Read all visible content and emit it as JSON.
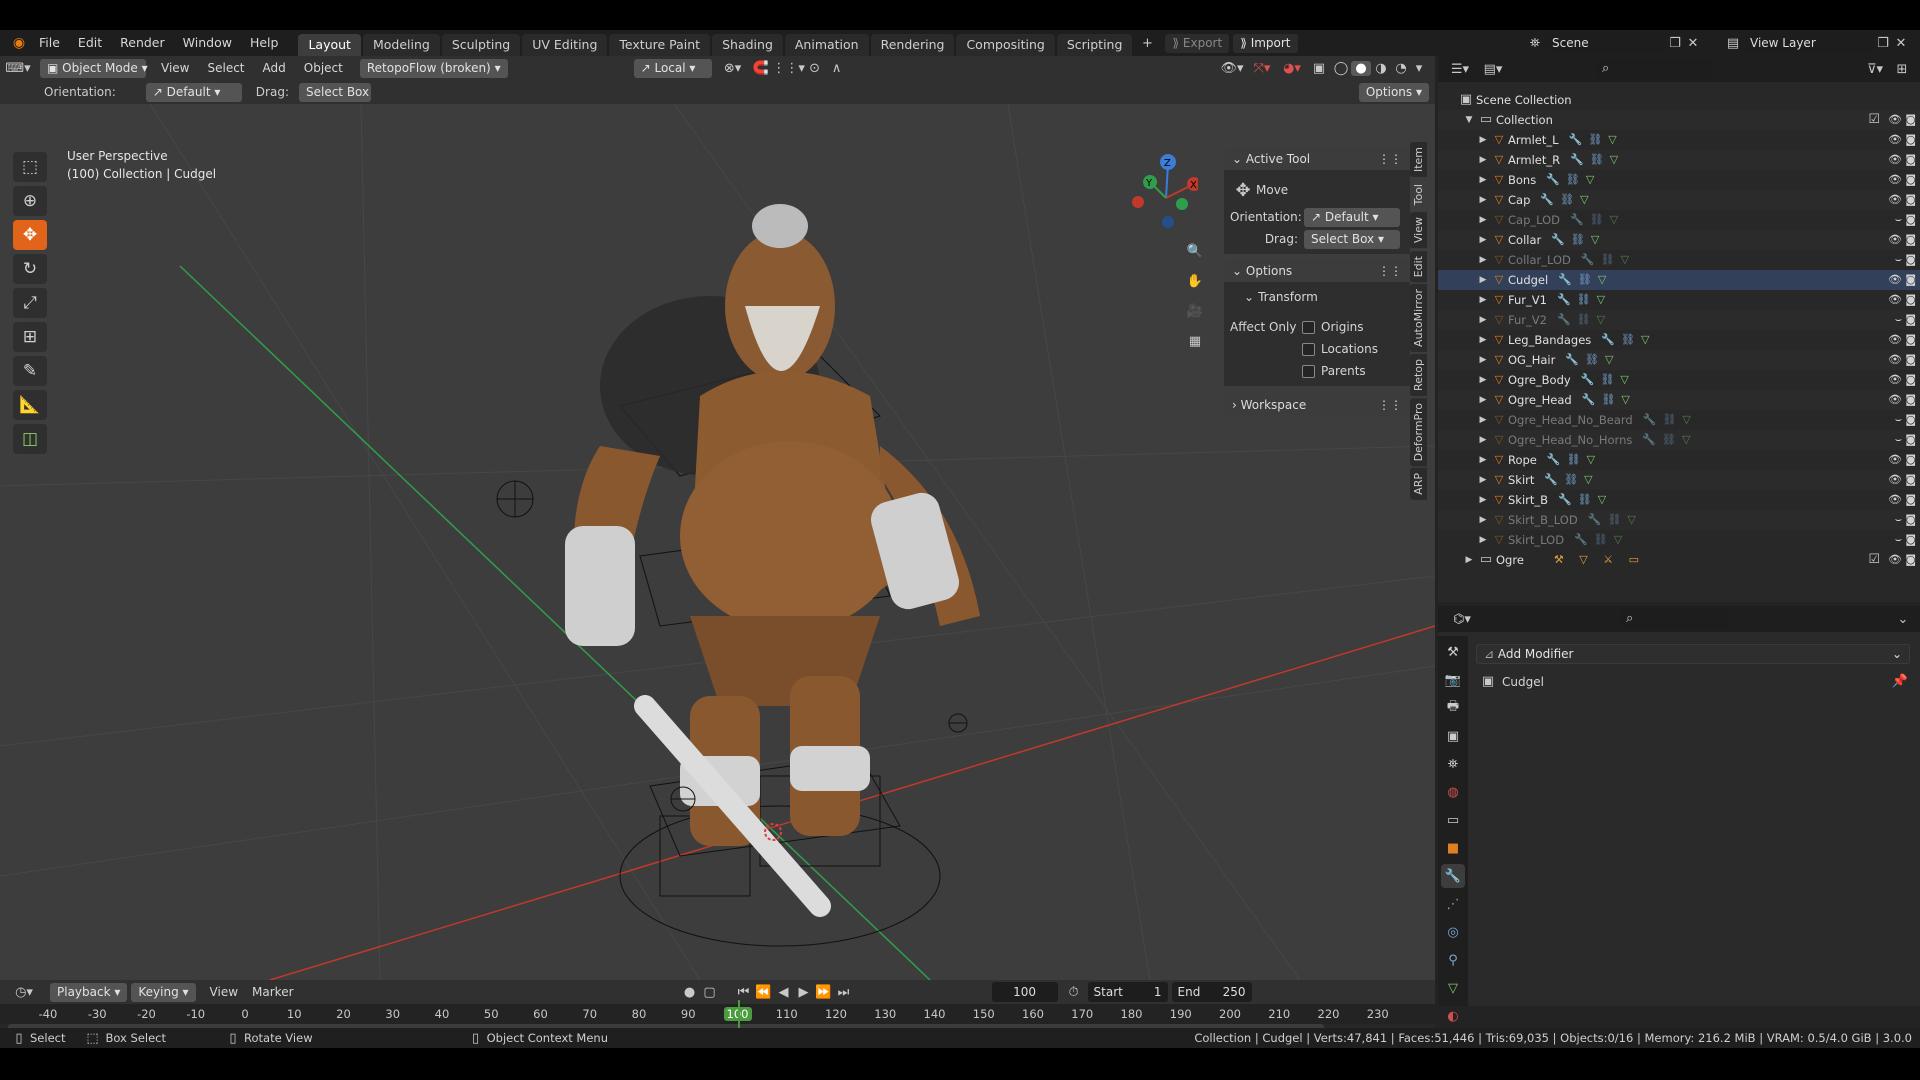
{
  "topbar": {
    "menus": [
      "File",
      "Edit",
      "Render",
      "Window",
      "Help"
    ],
    "workspaces": [
      "Layout",
      "Modeling",
      "Sculpting",
      "UV Editing",
      "Texture Paint",
      "Shading",
      "Animation",
      "Rendering",
      "Compositing",
      "Scripting"
    ],
    "active_workspace": "Layout",
    "export_label": "Export",
    "import_label": "Import",
    "scene_label": "Scene",
    "view_layer_label": "View Layer"
  },
  "viewport": {
    "mode": "Object Mode",
    "menus": [
      "View",
      "Select",
      "Add",
      "Object"
    ],
    "addon_dropdown": "RetopoFlow (broken)",
    "transform_space": "Local",
    "orientation_label": "Orientation:",
    "orientation_value": "Default",
    "drag_label": "Drag:",
    "drag_value": "Select Box",
    "options_label": "Options",
    "overlay_line1": "User Perspective",
    "overlay_line2": "(100) Collection | Cudgel",
    "tools": [
      "select-box",
      "cursor",
      "move",
      "rotate",
      "scale",
      "transform",
      "annotate",
      "measure",
      "add-cube"
    ],
    "active_tool_index": 2
  },
  "npanel": {
    "active_tool_title": "Active Tool",
    "tool_name": "Move",
    "orientation_label": "Orientation:",
    "orientation_value": "Default",
    "drag_label": "Drag:",
    "drag_value": "Select Box",
    "options_title": "Options",
    "transform_title": "Transform",
    "affect_only_label": "Affect Only",
    "checkboxes": [
      "Origins",
      "Locations",
      "Parents"
    ],
    "workspace_title": "Workspace",
    "side_tabs": [
      "Item",
      "Tool",
      "View",
      "Edit",
      "AutoMirror",
      "Retop",
      "DeformPro",
      "ARP"
    ]
  },
  "outliner": {
    "scene_collection": "Scene Collection",
    "collection": "Collection",
    "items": [
      {
        "name": "Armlet_L",
        "dim": false
      },
      {
        "name": "Armlet_R",
        "dim": false
      },
      {
        "name": "Bons",
        "dim": false
      },
      {
        "name": "Cap",
        "dim": false
      },
      {
        "name": "Cap_LOD",
        "dim": true
      },
      {
        "name": "Collar",
        "dim": false
      },
      {
        "name": "Collar_LOD",
        "dim": true
      },
      {
        "name": "Cudgel",
        "dim": false
      },
      {
        "name": "Fur_V1",
        "dim": false
      },
      {
        "name": "Fur_V2",
        "dim": true
      },
      {
        "name": "Leg_Bandages",
        "dim": false
      },
      {
        "name": "OG_Hair",
        "dim": false
      },
      {
        "name": "Ogre_Body",
        "dim": false
      },
      {
        "name": "Ogre_Head",
        "dim": false
      },
      {
        "name": "Ogre_Head_No_Beard",
        "dim": true
      },
      {
        "name": "Ogre_Head_No_Horns",
        "dim": true
      },
      {
        "name": "Rope",
        "dim": false
      },
      {
        "name": "Skirt",
        "dim": false
      },
      {
        "name": "Skirt_B",
        "dim": false
      },
      {
        "name": "Skirt_B_LOD",
        "dim": true
      },
      {
        "name": "Skirt_LOD",
        "dim": true
      }
    ],
    "second_collection": "Ogre"
  },
  "properties": {
    "add_modifier": "Add Modifier",
    "object_name": "Cudgel"
  },
  "timeline": {
    "playback": "Playback",
    "keying": "Keying",
    "view": "View",
    "marker": "Marker",
    "current_frame": "100",
    "start_label": "Start",
    "start_value": "1",
    "end_label": "End",
    "end_value": "250",
    "ruler": [
      "-40",
      "-30",
      "-20",
      "-10",
      "0",
      "10",
      "20",
      "30",
      "40",
      "50",
      "60",
      "70",
      "80",
      "90",
      "100",
      "110",
      "120",
      "130",
      "140",
      "150",
      "160",
      "170",
      "180",
      "190",
      "200",
      "210",
      "220",
      "230"
    ]
  },
  "status": {
    "select": "Select",
    "box_select": "Box Select",
    "rotate_view": "Rotate View",
    "context_menu": "Object Context Menu",
    "stats": "Collection | Cudgel | Verts:47,841 | Faces:51,446 | Tris:69,035 | Objects:0/16 | Memory: 216.2 MiB | VRAM: 0.5/4.0 GiB | 3.0.0"
  },
  "colors": {
    "accent": "#e2641a",
    "frame_marker": "#4a9c3f",
    "mesh_icon": "#e0801f",
    "x_axis": "#c0392b",
    "y_axis": "#2f9e4a",
    "z_axis": "#3b7dd8"
  }
}
